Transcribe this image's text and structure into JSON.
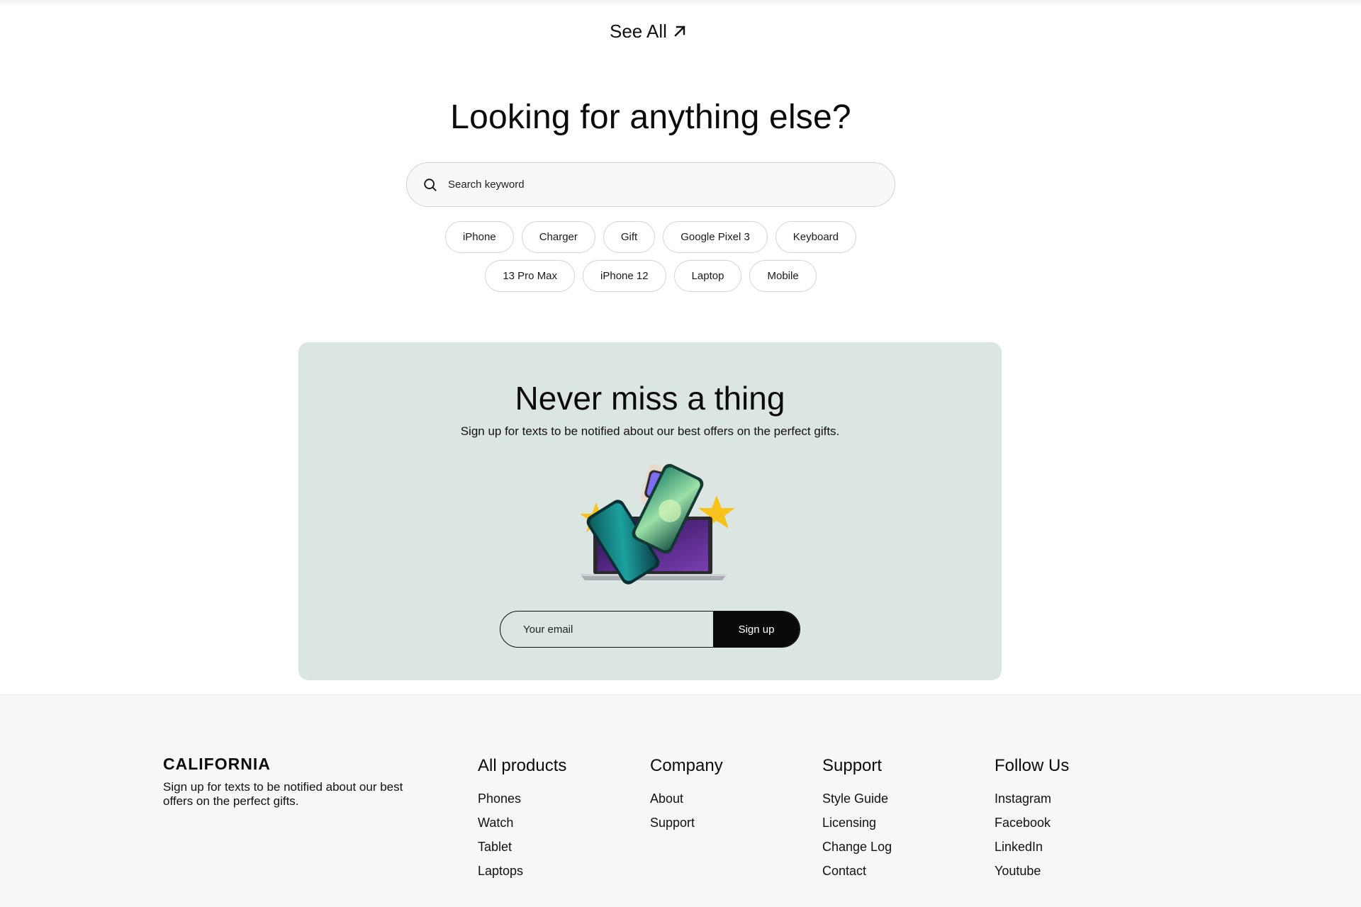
{
  "see_all": {
    "label": "See All",
    "icon": "arrow-up-right-icon"
  },
  "lookup": {
    "title": "Looking for anything else?",
    "search_placeholder": "Search keyword",
    "search_icon": "search-icon",
    "tags_row1": [
      "iPhone",
      "Charger",
      "Gift",
      "Google Pixel 3",
      "Keyboard"
    ],
    "tags_row2": [
      "13 Pro Max",
      "iPhone 12",
      "Laptop",
      "Mobile"
    ]
  },
  "newsletter": {
    "title": "Never miss a thing",
    "subtitle": "Sign up for texts to be notified about our best offers on the perfect gifts.",
    "email_placeholder": "Your email",
    "signup_label": "Sign up",
    "background": "#dbe6e2"
  },
  "footer": {
    "brand": "CALIFORNIA",
    "description": "Sign up for texts to be notified about our best offers on the perfect gifts.",
    "columns": [
      {
        "title": "All products",
        "links": [
          "Phones",
          "Watch",
          "Tablet",
          "Laptops"
        ]
      },
      {
        "title": "Company",
        "links": [
          "About",
          "Support"
        ]
      },
      {
        "title": "Support",
        "links": [
          "Style Guide",
          "Licensing",
          "Change Log",
          "Contact"
        ]
      },
      {
        "title": "Follow Us",
        "links": [
          "Instagram",
          "Facebook",
          "LinkedIn",
          "Youtube"
        ]
      }
    ]
  }
}
